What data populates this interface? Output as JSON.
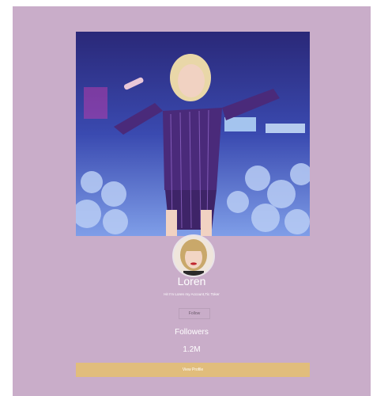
{
  "profile": {
    "name": "Loren",
    "bio": "Hi! I'm Loren my Account,Tic Toker",
    "follow_label": "Follow",
    "followers_label": "Followers",
    "followers_count": "1.2M",
    "view_profile_label": "View Profile"
  },
  "colors": {
    "card_background": "#c9adc9",
    "view_button": "#e1bd7c"
  },
  "images": {
    "cover": "cover-photo",
    "avatar": "avatar-photo"
  }
}
